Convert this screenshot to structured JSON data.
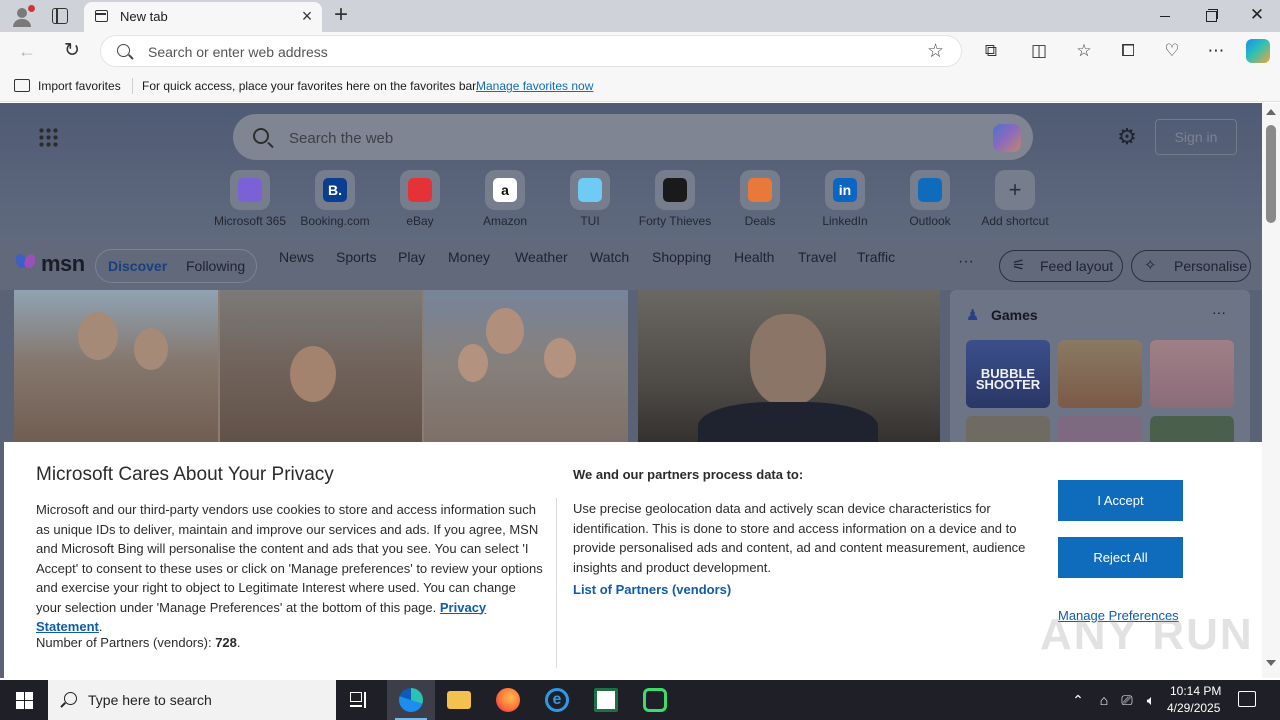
{
  "browser": {
    "tab_title": "New tab",
    "address_placeholder": "Search or enter web address"
  },
  "favorites_bar": {
    "import_label": "Import favorites",
    "hint_text": "For quick access, place your favorites here on the favorites bar.",
    "manage_link": "Manage favorites now"
  },
  "newtab": {
    "search_placeholder": "Search the web",
    "signin_label": "Sign in",
    "shortcuts": [
      {
        "label": "Microsoft 365",
        "icon": "microsoft-365-icon",
        "color": "#7b61d6"
      },
      {
        "label": "Booking.com",
        "icon": "booking-icon",
        "glyph": "B.",
        "color": "#0b3d91"
      },
      {
        "label": "eBay",
        "icon": "ebay-icon",
        "color": "#e53238"
      },
      {
        "label": "Amazon",
        "icon": "amazon-icon",
        "glyph": "a",
        "color": "#ffffff"
      },
      {
        "label": "TUI",
        "icon": "tui-icon",
        "color": "#70cbf4"
      },
      {
        "label": "Forty Thieves",
        "icon": "forty-thieves-icon",
        "color": "#1a1a1a"
      },
      {
        "label": "Deals",
        "icon": "deals-icon",
        "color": "#e8793a"
      },
      {
        "label": "LinkedIn",
        "icon": "linkedin-icon",
        "glyph": "in",
        "color": "#0a66c2"
      },
      {
        "label": "Outlook",
        "icon": "outlook-icon",
        "color": "#0f6cbd"
      },
      {
        "label": "Add shortcut",
        "icon": "plus-icon",
        "glyph": "+",
        "color": "#767d8c"
      }
    ]
  },
  "msn": {
    "brand": "msn",
    "pill_discover": "Discover",
    "pill_following": "Following",
    "nav": [
      "News",
      "Sports",
      "Play",
      "Money",
      "Weather",
      "Watch",
      "Shopping",
      "Health",
      "Travel",
      "Traffic"
    ],
    "more_label": "···",
    "feed_layout_label": "Feed layout",
    "personalise_label": "Personalise",
    "games_title": "Games",
    "games_more": "···",
    "game_tile_1_label": "BUBBLE SHOOTER"
  },
  "privacy": {
    "title": "Microsoft Cares About Your Privacy",
    "body": "Microsoft and our third-party vendors use cookies to store and access information such as unique IDs to deliver, maintain and improve our services and ads. If you agree, MSN and Microsoft Bing will personalise the content and ads that you see. You can select 'I Accept' to consent to these uses or click on 'Manage preferences' to review your options and exercise your right to object to Legitimate Interest where used.  You can change your selection under 'Manage Preferences' at the bottom of this page.",
    "privacy_link": "Privacy Statement",
    "partners_count_label": "Number of Partners (vendors):",
    "partners_count": "728",
    "purposes_heading": "We and our partners process data to:",
    "purposes_body": "Use precise geolocation data and actively scan device characteristics for identification. This is done to store and access information on a device and to provide personalised ads and content, ad and content measurement, audience insights and product development.",
    "partners_link": "List of Partners (vendors)",
    "accept_label": "I Accept",
    "reject_label": "Reject All",
    "manage_label": "Manage Preferences"
  },
  "taskbar": {
    "search_placeholder": "Type here to search",
    "time": "10:14 PM",
    "date": "4/29/2025"
  },
  "watermark": "ANY RUN",
  "colors": {
    "accent": "#0f6cbd",
    "link": "#0f5ca8",
    "taskbar": "#1f2027",
    "overlay_dim": "#5a6275"
  }
}
